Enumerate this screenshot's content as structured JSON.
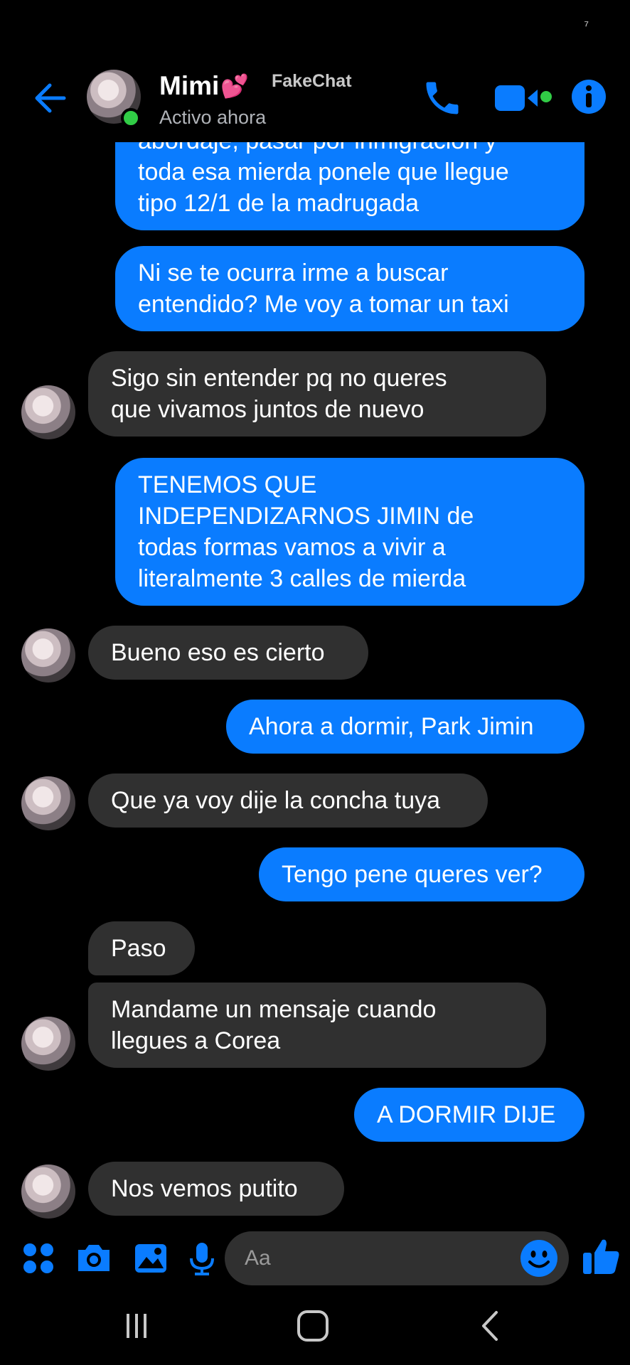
{
  "status_bar": {
    "indicator": "⁷"
  },
  "header": {
    "contact_name": "Mimi",
    "contact_emoji": "💕",
    "status": "Activo ahora",
    "watermark": "FakeChat",
    "icons": [
      "back-arrow-icon",
      "phone-icon",
      "video-camera-icon",
      "info-icon"
    ]
  },
  "messages": [
    {
      "from": "me",
      "lines": [
        "abordaje, pasar por inmigración y",
        "toda esa mierda ponele que llegue",
        "tipo 12/1 de la madrugada"
      ]
    },
    {
      "from": "me",
      "lines": [
        "Ni se te ocurra irme a buscar",
        "entendido? Me voy a tomar un taxi"
      ]
    },
    {
      "from": "them",
      "lines": [
        "Sigo sin entender pq no queres",
        "que vivamos juntos de nuevo"
      ]
    },
    {
      "from": "me",
      "lines": [
        "TENEMOS QUE",
        "INDEPENDIZARNOS JIMIN de",
        "todas formas vamos a vivir a",
        "literalmente 3 calles de mierda"
      ]
    },
    {
      "from": "them",
      "lines": [
        "Bueno eso es cierto"
      ]
    },
    {
      "from": "me",
      "lines": [
        "Ahora a dormir, Park Jimin"
      ]
    },
    {
      "from": "them",
      "lines": [
        "Que ya voy dije la concha tuya"
      ]
    },
    {
      "from": "me",
      "lines": [
        "Tengo pene queres ver?"
      ]
    },
    {
      "from": "them",
      "lines": [
        "Paso"
      ]
    },
    {
      "from": "them",
      "lines": [
        "Mandame un mensaje cuando",
        "llegues a Corea"
      ]
    },
    {
      "from": "me",
      "lines": [
        "A DORMIR DIJE"
      ]
    },
    {
      "from": "them",
      "lines": [
        "Nos vemos putito"
      ]
    }
  ],
  "composer": {
    "placeholder": "Aa",
    "icons": [
      "apps-grid-icon",
      "camera-icon",
      "image-icon",
      "microphone-icon",
      "emoji-icon",
      "thumbs-up-icon"
    ]
  },
  "nav": {
    "icons": [
      "recent-apps-icon",
      "home-icon",
      "back-icon"
    ]
  },
  "colors": {
    "accent": "#0a7cff",
    "received_bubble": "#303030",
    "background": "#000000",
    "online": "#31cc46",
    "status_text": "#b0b3b8"
  }
}
